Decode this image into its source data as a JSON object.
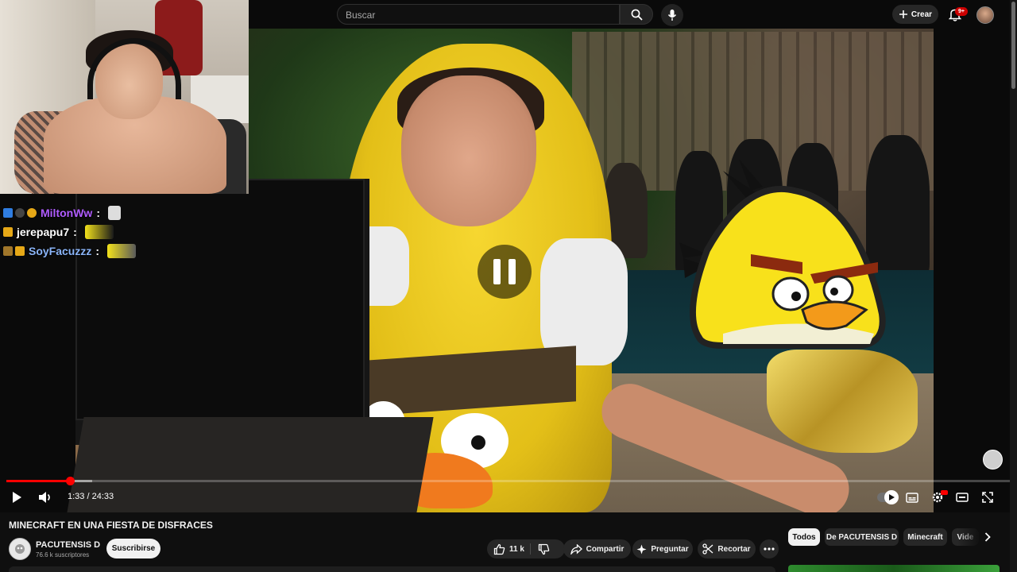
{
  "header": {
    "search_placeholder": "Buscar",
    "create_label": "Crear",
    "notification_count": "9+"
  },
  "chat": [
    {
      "username": "MiltonWw",
      "color": "#b05cff",
      "sep": ":"
    },
    {
      "username": "jerepapu7",
      "color": "#ffffff",
      "sep": ":"
    },
    {
      "username": "SoyFacuzzz",
      "color": "#8ab4f8",
      "sep": ":"
    }
  ],
  "player": {
    "current_time": "1:33",
    "duration": "24:33",
    "time_display": "1:33 / 24:33",
    "progress_fraction": 0.063,
    "state": "playing",
    "accent_color": "#ff0000"
  },
  "video": {
    "title": "MINECRAFT EN UNA FIESTA DE DISFRACES",
    "channel_name": "PACUTENSIS D",
    "subscribers": "76.6 k suscriptores",
    "subscribe_label": "Suscribirse",
    "like_count": "11 k",
    "share_label": "Compartir",
    "ask_label": "Preguntar",
    "clip_label": "Recortar"
  },
  "chips": {
    "items": [
      {
        "label": "Todos",
        "active": true
      },
      {
        "label": "De PACUTENSIS D",
        "active": false
      },
      {
        "label": "Minecraft",
        "active": false
      },
      {
        "label": "Vide",
        "active": false
      }
    ]
  },
  "icons": [
    "search-icon",
    "mic-icon",
    "plus-icon",
    "bell-icon",
    "pause-icon",
    "play-icon",
    "volume-icon",
    "autoplay-icon",
    "subtitles-icon",
    "settings-icon",
    "theater-icon",
    "fullscreen-icon",
    "like-icon",
    "dislike-icon",
    "share-icon",
    "sparkle-icon",
    "scissors-icon",
    "more-icon",
    "chevron-right-icon"
  ]
}
